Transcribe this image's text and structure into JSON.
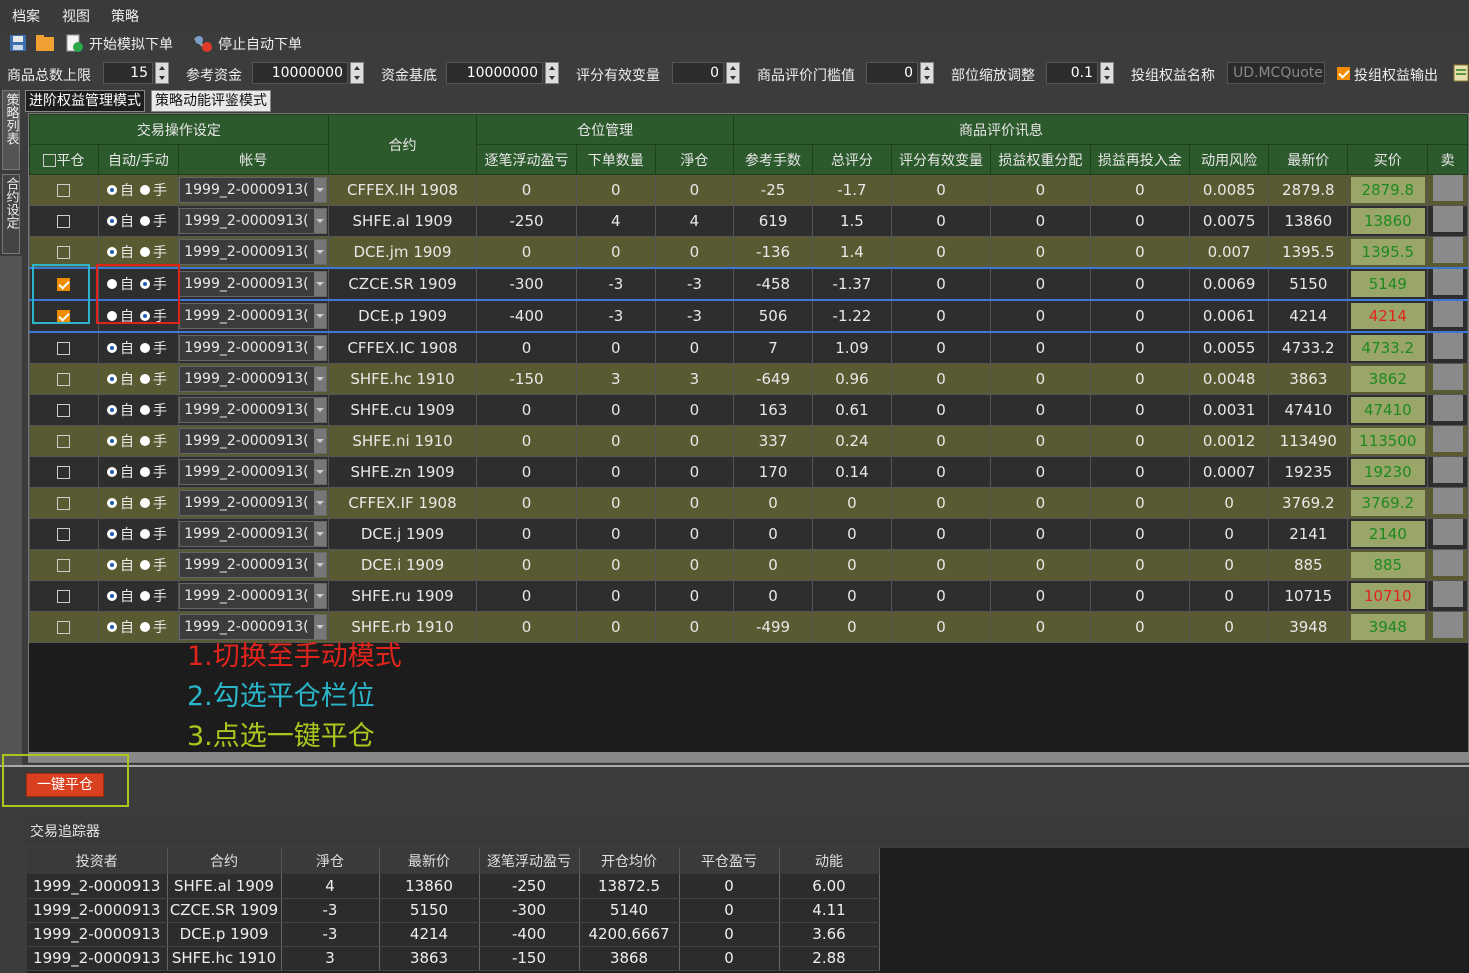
{
  "menu": {
    "file": "档案",
    "view": "视图",
    "strategy": "策略"
  },
  "toolbar": {
    "start_label": "开始模拟下单",
    "stop_label": "停止自动下单"
  },
  "params": {
    "total_limit_label": "商品总数上限",
    "total_limit_value": "15",
    "ref_capital_label": "参考资金",
    "ref_capital_value": "10000000",
    "capital_base_label": "资金基底",
    "capital_base_value": "10000000",
    "score_var_label": "评分有效变量",
    "score_var_value": "0",
    "threshold_label": "商品评价门槛值",
    "threshold_value": "0",
    "scale_label": "部位缩放调整",
    "scale_value": "0.1",
    "portfolio_name_label": "投组权益名称",
    "portfolio_name_value": "UD.MCQuote",
    "portfolio_output_label": "投组权益输出"
  },
  "side_tabs": {
    "strategy_list": "策略列表",
    "contract_settings": "合约设定"
  },
  "mode_tabs": {
    "advanced": "进阶权益管理模式",
    "kinetic": "策略动能评鉴模式"
  },
  "grid": {
    "group_trade": "交易操作设定",
    "group_position": "仓位管理",
    "group_eval": "商品评价讯息",
    "col_close": "平仓",
    "col_mode": "自动/手动",
    "col_account": "帐号",
    "col_contract": "合约",
    "col_float_pnl": "逐笔浮动盈亏",
    "col_order_qty": "下单数量",
    "col_net": "淨仓",
    "col_ref_lots": "参考手数",
    "col_total_score": "总评分",
    "col_score_var": "评分有效变量",
    "col_pnl_weight": "损益权重分配",
    "col_pnl_reinvest": "损益再投入金",
    "col_risk": "动用风险",
    "col_last": "最新价",
    "col_bid": "买价",
    "col_extra": "卖",
    "radio_auto": "自",
    "radio_manual": "手",
    "rows": [
      {
        "close": false,
        "manual": false,
        "account": "1999_2-0000913(",
        "contract": "CFFEX.IH 1908",
        "float_pnl": "0",
        "order_qty": "0",
        "net": "0",
        "ref_lots": "-25",
        "total_score": "-1.7",
        "score_var": "0",
        "pnl_weight": "0",
        "reinvest": "0",
        "risk": "0.0085",
        "last": "2879.8",
        "bid": "2879.8",
        "bid_color": "g"
      },
      {
        "close": false,
        "manual": false,
        "account": "1999_2-0000913(",
        "contract": "SHFE.al 1909",
        "float_pnl": "-250",
        "order_qty": "4",
        "net": "4",
        "ref_lots": "619",
        "total_score": "1.5",
        "score_var": "0",
        "pnl_weight": "0",
        "reinvest": "0",
        "risk": "0.0075",
        "last": "13860",
        "bid": "13860",
        "bid_color": "g"
      },
      {
        "close": false,
        "manual": false,
        "account": "1999_2-0000913(",
        "contract": "DCE.jm 1909",
        "float_pnl": "0",
        "order_qty": "0",
        "net": "0",
        "ref_lots": "-136",
        "total_score": "1.4",
        "score_var": "0",
        "pnl_weight": "0",
        "reinvest": "0",
        "risk": "0.007",
        "last": "1395.5",
        "bid": "1395.5",
        "bid_color": "g"
      },
      {
        "close": true,
        "manual": true,
        "account": "1999_2-0000913(",
        "contract": "CZCE.SR 1909",
        "float_pnl": "-300",
        "order_qty": "-3",
        "net": "-3",
        "ref_lots": "-458",
        "total_score": "-1.37",
        "score_var": "0",
        "pnl_weight": "0",
        "reinvest": "0",
        "risk": "0.0069",
        "last": "5150",
        "bid": "5149",
        "bid_color": "g"
      },
      {
        "close": true,
        "manual": true,
        "account": "1999_2-0000913(",
        "contract": "DCE.p 1909",
        "float_pnl": "-400",
        "order_qty": "-3",
        "net": "-3",
        "ref_lots": "506",
        "total_score": "-1.22",
        "score_var": "0",
        "pnl_weight": "0",
        "reinvest": "0",
        "risk": "0.0061",
        "last": "4214",
        "bid": "4214",
        "bid_color": "r"
      },
      {
        "close": false,
        "manual": false,
        "account": "1999_2-0000913(",
        "contract": "CFFEX.IC 1908",
        "float_pnl": "0",
        "order_qty": "0",
        "net": "0",
        "ref_lots": "7",
        "total_score": "1.09",
        "score_var": "0",
        "pnl_weight": "0",
        "reinvest": "0",
        "risk": "0.0055",
        "last": "4733.2",
        "bid": "4733.2",
        "bid_color": "g"
      },
      {
        "close": false,
        "manual": false,
        "account": "1999_2-0000913(",
        "contract": "SHFE.hc 1910",
        "float_pnl": "-150",
        "order_qty": "3",
        "net": "3",
        "ref_lots": "-649",
        "total_score": "0.96",
        "score_var": "0",
        "pnl_weight": "0",
        "reinvest": "0",
        "risk": "0.0048",
        "last": "3863",
        "bid": "3862",
        "bid_color": "g"
      },
      {
        "close": false,
        "manual": false,
        "account": "1999_2-0000913(",
        "contract": "SHFE.cu 1909",
        "float_pnl": "0",
        "order_qty": "0",
        "net": "0",
        "ref_lots": "163",
        "total_score": "0.61",
        "score_var": "0",
        "pnl_weight": "0",
        "reinvest": "0",
        "risk": "0.0031",
        "last": "47410",
        "bid": "47410",
        "bid_color": "g"
      },
      {
        "close": false,
        "manual": false,
        "account": "1999_2-0000913(",
        "contract": "SHFE.ni 1910",
        "float_pnl": "0",
        "order_qty": "0",
        "net": "0",
        "ref_lots": "337",
        "total_score": "0.24",
        "score_var": "0",
        "pnl_weight": "0",
        "reinvest": "0",
        "risk": "0.0012",
        "last": "113490",
        "bid": "113500",
        "bid_color": "g"
      },
      {
        "close": false,
        "manual": false,
        "account": "1999_2-0000913(",
        "contract": "SHFE.zn 1909",
        "float_pnl": "0",
        "order_qty": "0",
        "net": "0",
        "ref_lots": "170",
        "total_score": "0.14",
        "score_var": "0",
        "pnl_weight": "0",
        "reinvest": "0",
        "risk": "0.0007",
        "last": "19235",
        "bid": "19230",
        "bid_color": "g"
      },
      {
        "close": false,
        "manual": false,
        "account": "1999_2-0000913(",
        "contract": "CFFEX.IF 1908",
        "float_pnl": "0",
        "order_qty": "0",
        "net": "0",
        "ref_lots": "0",
        "total_score": "0",
        "score_var": "0",
        "pnl_weight": "0",
        "reinvest": "0",
        "risk": "0",
        "last": "3769.2",
        "bid": "3769.2",
        "bid_color": "g"
      },
      {
        "close": false,
        "manual": false,
        "account": "1999_2-0000913(",
        "contract": "DCE.j 1909",
        "float_pnl": "0",
        "order_qty": "0",
        "net": "0",
        "ref_lots": "0",
        "total_score": "0",
        "score_var": "0",
        "pnl_weight": "0",
        "reinvest": "0",
        "risk": "0",
        "last": "2141",
        "bid": "2140",
        "bid_color": "g"
      },
      {
        "close": false,
        "manual": false,
        "account": "1999_2-0000913(",
        "contract": "DCE.i 1909",
        "float_pnl": "0",
        "order_qty": "0",
        "net": "0",
        "ref_lots": "0",
        "total_score": "0",
        "score_var": "0",
        "pnl_weight": "0",
        "reinvest": "0",
        "risk": "0",
        "last": "885",
        "bid": "885",
        "bid_color": "g"
      },
      {
        "close": false,
        "manual": false,
        "account": "1999_2-0000913(",
        "contract": "SHFE.ru 1909",
        "float_pnl": "0",
        "order_qty": "0",
        "net": "0",
        "ref_lots": "0",
        "total_score": "0",
        "score_var": "0",
        "pnl_weight": "0",
        "reinvest": "0",
        "risk": "0",
        "last": "10715",
        "bid": "10710",
        "bid_color": "r"
      },
      {
        "close": false,
        "manual": false,
        "account": "1999_2-0000913(",
        "contract": "SHFE.rb 1910",
        "float_pnl": "0",
        "order_qty": "0",
        "net": "0",
        "ref_lots": "-499",
        "total_score": "0",
        "score_var": "0",
        "pnl_weight": "0",
        "reinvest": "0",
        "risk": "0",
        "last": "3948",
        "bid": "3948",
        "bid_color": "g"
      }
    ]
  },
  "annotations": {
    "step1": "1.切换至手动模式",
    "step2": "2.勾选平仓栏位",
    "step3": "3.点选一键平仓",
    "step1_color": "#e0241b",
    "step2_color": "#2ab5c9",
    "step3_color": "#a8c81e"
  },
  "close_all_button": "一键平仓",
  "tracker": {
    "title": "交易追踪器",
    "headers": [
      "投资者",
      "合约",
      "淨仓",
      "最新价",
      "逐笔浮动盈亏",
      "开仓均价",
      "平仓盈亏",
      "动能"
    ],
    "rows": [
      [
        "1999_2-0000913",
        "SHFE.al 1909",
        "4",
        "13860",
        "-250",
        "13872.5",
        "0",
        "6.00"
      ],
      [
        "1999_2-0000913",
        "CZCE.SR 1909",
        "-3",
        "5150",
        "-300",
        "5140",
        "0",
        "4.11"
      ],
      [
        "1999_2-0000913",
        "DCE.p 1909",
        "-3",
        "4214",
        "-400",
        "4200.6667",
        "0",
        "3.66"
      ],
      [
        "1999_2-0000913",
        "SHFE.hc 1910",
        "3",
        "3863",
        "-150",
        "3868",
        "0",
        "2.88"
      ]
    ]
  },
  "colors": {
    "header_green": "#2d5a2d",
    "row_olive": "#5a5a32",
    "row_dark": "#2e2e2e",
    "button_red": "#d8401f"
  }
}
